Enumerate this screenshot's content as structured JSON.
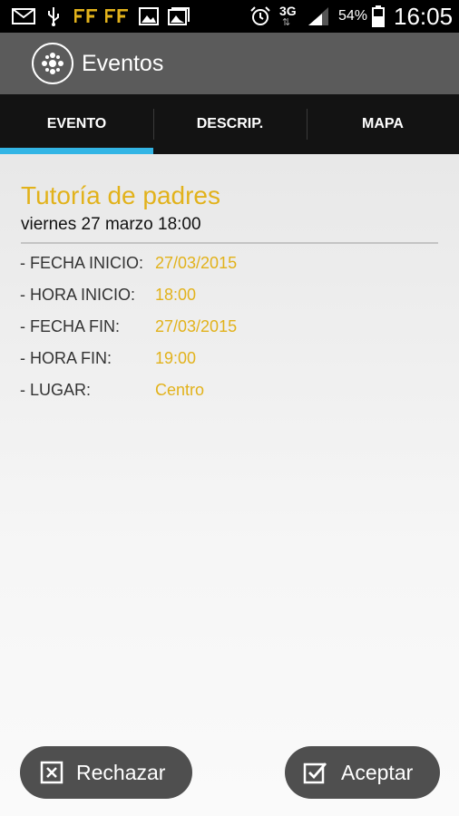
{
  "status_bar": {
    "icons": [
      "mail-icon",
      "usb-icon",
      "ff-app-icon",
      "ff-app-icon",
      "image-icon",
      "gallery-icon",
      "alarm-icon",
      "network-3g-icon",
      "signal-icon",
      "battery-icon"
    ],
    "network": "3G",
    "battery": "54%",
    "time": "16:05"
  },
  "header": {
    "title": "Eventos"
  },
  "tabs": [
    {
      "label": "EVENTO",
      "active": true
    },
    {
      "label": "DESCRIP.",
      "active": false
    },
    {
      "label": "MAPA",
      "active": false
    }
  ],
  "event": {
    "title": "Tutoría de padres",
    "subtitle": "viernes 27 marzo 18:00",
    "details": [
      {
        "label": "- FECHA INICIO:",
        "value": "27/03/2015"
      },
      {
        "label": "- HORA INICIO:",
        "value": "18:00"
      },
      {
        "label": "- FECHA FIN:",
        "value": "27/03/2015"
      },
      {
        "label": "- HORA FIN:",
        "value": "19:00"
      },
      {
        "label": "- LUGAR:",
        "value": "Centro"
      }
    ]
  },
  "actions": {
    "reject": "Rechazar",
    "accept": "Aceptar"
  },
  "colors": {
    "accent": "#e2b21b",
    "tab_indicator": "#33b5e5"
  }
}
